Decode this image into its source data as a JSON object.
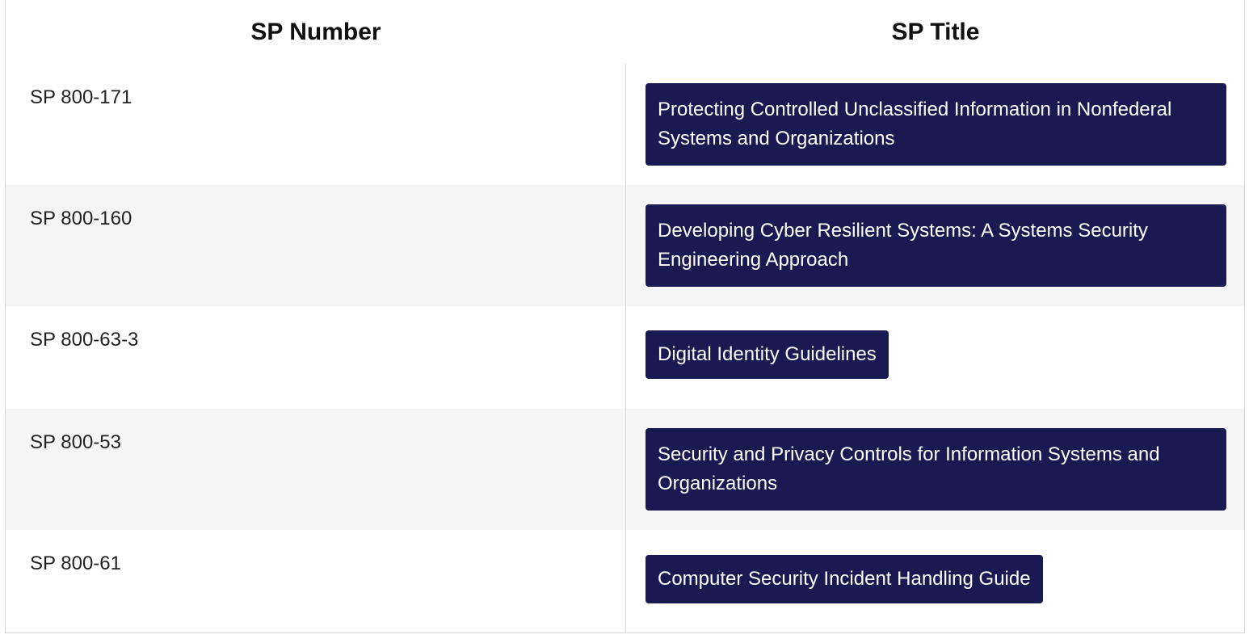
{
  "table": {
    "headers": {
      "sp_number": "SP Number",
      "sp_title": "SP Title"
    },
    "rows": [
      {
        "number": "SP 800-171",
        "title": "Protecting Controlled Unclassified Information in Nonfederal Systems and Organizations"
      },
      {
        "number": "SP 800-160",
        "title": "Developing Cyber Resilient Systems: A Systems Security Engineering Approach"
      },
      {
        "number": "SP 800-63-3",
        "title": "Digital Identity Guidelines"
      },
      {
        "number": "SP 800-53",
        "title": "Security and Privacy Controls for Information Systems and Organizations"
      },
      {
        "number": "SP 800-61",
        "title": "Computer Security Incident Handling Guide"
      }
    ]
  },
  "colors": {
    "button_bg": "#1a1a52",
    "alt_row_bg": "#f5f5f5",
    "border": "#d6d6d6"
  }
}
